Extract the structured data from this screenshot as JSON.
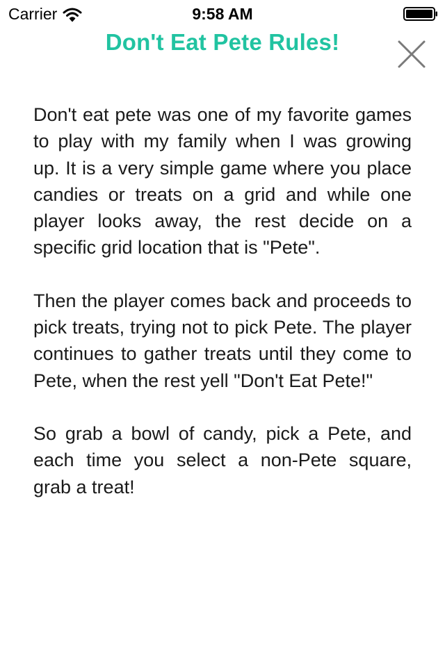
{
  "status_bar": {
    "carrier": "Carrier",
    "time": "9:58 AM",
    "wifi_icon": "wifi-icon",
    "battery_icon": "battery-icon"
  },
  "header": {
    "title": "Don't Eat Pete Rules!",
    "title_color": "#21c3a1",
    "close_icon": "close-icon"
  },
  "rules": {
    "paragraphs": [
      "Don't eat pete was one of my favorite games to play with my family when I was growing up. It is a very simple game where you place candies or treats on a grid and while one player looks away, the rest decide on a specific grid location that is \"Pete\".",
      "Then the player comes back and proceeds to pick treats, trying not to pick Pete. The player continues to gather treats until they come to Pete, when the rest yell \"Don't Eat Pete!\"",
      "So grab a bowl of candy, pick a Pete, and each time you select a non-Pete square, grab a treat!"
    ]
  }
}
